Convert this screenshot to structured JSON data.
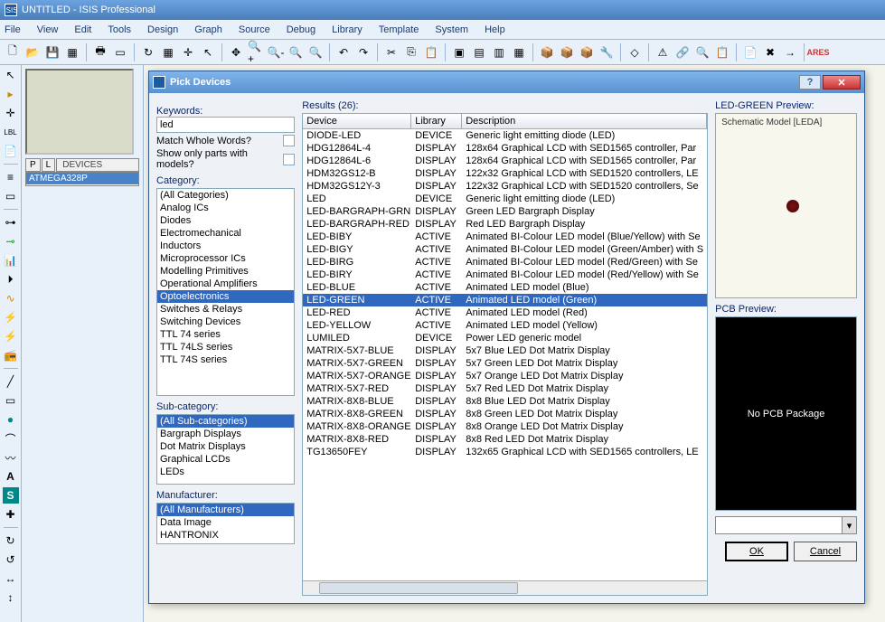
{
  "window": {
    "title": "UNTITLED - ISIS Professional",
    "app_icon": "ISIS"
  },
  "menu": [
    "File",
    "View",
    "Edit",
    "Tools",
    "Design",
    "Graph",
    "Source",
    "Debug",
    "Library",
    "Template",
    "System",
    "Help"
  ],
  "left_panel": {
    "tabs": [
      "P",
      "L"
    ],
    "tabs_label": "DEVICES",
    "selected_device": "ATMEGA328P"
  },
  "dialog": {
    "title": "Pick Devices",
    "keywords_label": "Keywords:",
    "keywords_value": "led",
    "match_label": "Match Whole Words?",
    "models_label": "Show only parts with models?",
    "category_label": "Category:",
    "categories": [
      "(All Categories)",
      "Analog ICs",
      "Diodes",
      "Electromechanical",
      "Inductors",
      "Microprocessor ICs",
      "Modelling Primitives",
      "Operational Amplifiers",
      "Optoelectronics",
      "Switches & Relays",
      "Switching Devices",
      "TTL 74 series",
      "TTL 74LS series",
      "TTL 74S series"
    ],
    "category_selected": "Optoelectronics",
    "subcat_label": "Sub-category:",
    "subcategories": [
      "(All Sub-categories)",
      "Bargraph Displays",
      "Dot Matrix Displays",
      "Graphical LCDs",
      "LEDs"
    ],
    "subcat_selected": "(All Sub-categories)",
    "manu_label": "Manufacturer:",
    "manufacturers": [
      "(All Manufacturers)",
      "Data Image",
      "HANTRONIX"
    ],
    "manu_selected": "(All Manufacturers)",
    "results_label": "Results (26):",
    "columns": {
      "device": "Device",
      "library": "Library",
      "description": "Description"
    },
    "rows": [
      {
        "d": "DIODE-LED",
        "l": "DEVICE",
        "x": "Generic light emitting diode (LED)"
      },
      {
        "d": "HDG12864L-4",
        "l": "DISPLAY",
        "x": "128x64 Graphical LCD with SED1565 controller, Par"
      },
      {
        "d": "HDG12864L-6",
        "l": "DISPLAY",
        "x": "128x64 Graphical LCD with SED1565 controller, Par"
      },
      {
        "d": "HDM32GS12-B",
        "l": "DISPLAY",
        "x": "122x32 Graphical LCD with SED1520 controllers, LE"
      },
      {
        "d": "HDM32GS12Y-3",
        "l": "DISPLAY",
        "x": "122x32 Graphical LCD with SED1520 controllers, Se"
      },
      {
        "d": "LED",
        "l": "DEVICE",
        "x": "Generic light emitting diode (LED)"
      },
      {
        "d": "LED-BARGRAPH-GRN",
        "l": "DISPLAY",
        "x": "Green LED Bargraph Display"
      },
      {
        "d": "LED-BARGRAPH-RED",
        "l": "DISPLAY",
        "x": "Red LED Bargraph Display"
      },
      {
        "d": "LED-BIBY",
        "l": "ACTIVE",
        "x": "Animated BI-Colour LED model (Blue/Yellow) with Se"
      },
      {
        "d": "LED-BIGY",
        "l": "ACTIVE",
        "x": "Animated BI-Colour LED model (Green/Amber) with S"
      },
      {
        "d": "LED-BIRG",
        "l": "ACTIVE",
        "x": "Animated BI-Colour LED model (Red/Green) with Se"
      },
      {
        "d": "LED-BIRY",
        "l": "ACTIVE",
        "x": "Animated BI-Colour LED model (Red/Yellow) with Se"
      },
      {
        "d": "LED-BLUE",
        "l": "ACTIVE",
        "x": "Animated LED model (Blue)"
      },
      {
        "d": "LED-GREEN",
        "l": "ACTIVE",
        "x": "Animated LED model (Green)"
      },
      {
        "d": "LED-RED",
        "l": "ACTIVE",
        "x": "Animated LED model (Red)"
      },
      {
        "d": "LED-YELLOW",
        "l": "ACTIVE",
        "x": "Animated LED model (Yellow)"
      },
      {
        "d": "LUMILED",
        "l": "DEVICE",
        "x": "Power LED generic model"
      },
      {
        "d": "MATRIX-5X7-BLUE",
        "l": "DISPLAY",
        "x": "5x7 Blue LED Dot Matrix Display"
      },
      {
        "d": "MATRIX-5X7-GREEN",
        "l": "DISPLAY",
        "x": "5x7 Green LED Dot Matrix Display"
      },
      {
        "d": "MATRIX-5X7-ORANGE",
        "l": "DISPLAY",
        "x": "5x7 Orange LED Dot Matrix Display"
      },
      {
        "d": "MATRIX-5X7-RED",
        "l": "DISPLAY",
        "x": "5x7 Red LED Dot Matrix Display"
      },
      {
        "d": "MATRIX-8X8-BLUE",
        "l": "DISPLAY",
        "x": "8x8 Blue LED Dot Matrix Display"
      },
      {
        "d": "MATRIX-8X8-GREEN",
        "l": "DISPLAY",
        "x": "8x8 Green LED Dot Matrix Display"
      },
      {
        "d": "MATRIX-8X8-ORANGE",
        "l": "DISPLAY",
        "x": "8x8 Orange LED Dot Matrix Display"
      },
      {
        "d": "MATRIX-8X8-RED",
        "l": "DISPLAY",
        "x": "8x8 Red LED Dot Matrix Display"
      },
      {
        "d": "TG13650FEY",
        "l": "DISPLAY",
        "x": "132x65 Graphical LCD with SED1565 controllers, LE"
      }
    ],
    "row_selected": "LED-GREEN",
    "preview_label": "LED-GREEN Preview:",
    "schematic_text": "Schematic Model [LEDA]",
    "pcb_label": "PCB Preview:",
    "pcb_text": "No PCB Package",
    "ok": "OK",
    "cancel": "Cancel"
  }
}
